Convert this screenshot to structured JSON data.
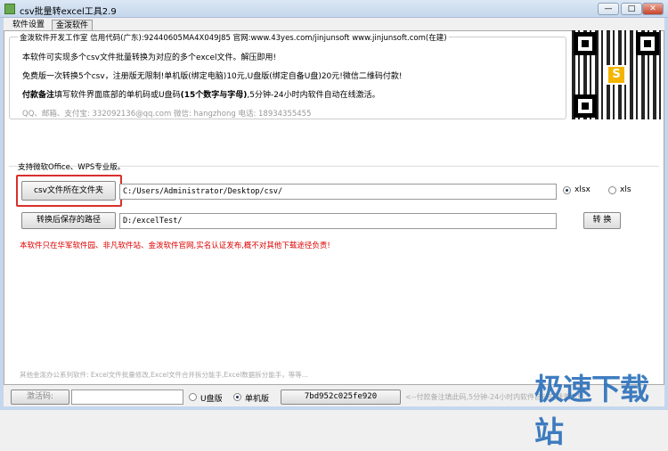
{
  "window": {
    "title": "csv批量转excel工具2.9",
    "minimize": "—",
    "maximize": "□",
    "close": "✕"
  },
  "tabs": [
    "软件设置",
    "金泼软件"
  ],
  "info": {
    "legend": "金泼软件开发工作室 信用代码(广东):92440605MA4X049J85 官网:www.43yes.com/jinjunsoft  www.jinjunsoft.com(在建)",
    "line1": "本软件可实现多个csv文件批量转换为对应的多个excel文件。解压即用!",
    "line2": "免费版一次转换5个csv，注册版无限制!单机版(绑定电脑)10元,U盘版(绑定自备U盘)20元!微信二维码付款!",
    "line3_bold": "付款备注",
    "line3": "填写软件界面底部的单机码或U盘码",
    "line3_bold2": "(15个数字与字母)",
    "line3_end": ",5分钟-24小时内软件自动在线激活。",
    "line4": "QQ、邮箱、支付宝: 332092136@qq.com    微信: hangzhong    电话: 18934355455"
  },
  "qr_logo": "S",
  "group_label": "支持微软Office、WPS专业版。",
  "csv_button": "csv文件所在文件夹",
  "csv_path": "C:/Users/Administrator/Desktop/csv/",
  "format_options": [
    {
      "label": "xlsx",
      "selected": true
    },
    {
      "label": "xls",
      "selected": false
    }
  ],
  "save_button": "转换后保存的路径",
  "save_path": "D:/excelTest/",
  "convert_button": "转 换",
  "notice": "本软件只在华军软件园、非凡软件站、金泼软件官网,实名认证发布,概不对其他下载途径负责!",
  "other_software": "其他金泼办公系列软件: Excel文件批量修改,Excel文件合并拆分能手,Excel数据拆分能手，等等...",
  "bottom": {
    "activation_label": "激活码:",
    "activation_value": "",
    "license_options": [
      {
        "label": "U盘版",
        "selected": false
      },
      {
        "label": "单机版",
        "selected": true
      }
    ],
    "machine_code": "7bd952c025fe920",
    "hint": "<--付款备注填此码,5分钟-24小时内软件自动在线激活!"
  },
  "watermark": "极速下载站"
}
